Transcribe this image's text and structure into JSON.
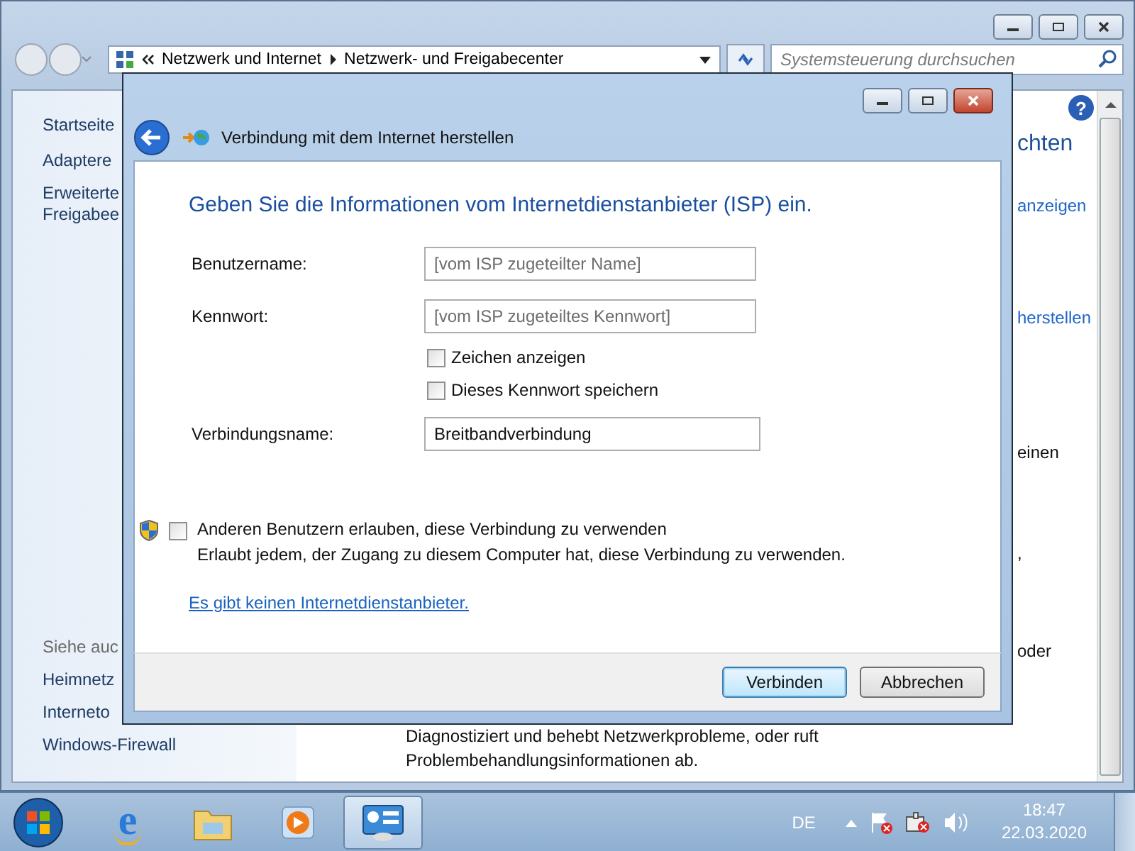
{
  "explorer": {
    "address_bar": {
      "segments": [
        "Netzwerk und Internet",
        "Netzwerk- und Freigabecenter"
      ]
    },
    "search": {
      "placeholder": "Systemsteuerung durchsuchen"
    },
    "help_glyph": "?",
    "sidebar": {
      "items": [
        "Startseite",
        "Adaptere",
        "Erweiterte Freigabee"
      ]
    },
    "see_also": {
      "heading": "Siehe auc",
      "items": [
        "Heimnetz",
        "Interneto",
        "Windows-Firewall"
      ]
    },
    "right_fragments": [
      {
        "kind": "heading",
        "text": "chten"
      },
      {
        "kind": "link",
        "text": "anzeigen"
      },
      {
        "kind": "link",
        "text": "herstellen"
      },
      {
        "kind": "text",
        "text": "einen"
      },
      {
        "kind": "text",
        "text": ","
      },
      {
        "kind": "text",
        "text": "oder"
      }
    ],
    "troubleshoot_description": "Diagnostiziert und behebt Netzwerkprobleme, oder ruft Problembehandlungsinformationen ab."
  },
  "dialog": {
    "title": "Verbindung mit dem Internet herstellen",
    "heading": "Geben Sie die Informationen vom Internetdienstanbieter (ISP) ein.",
    "fields": [
      {
        "label": "Benutzername:",
        "placeholder": "[vom ISP zugeteilter Name]"
      },
      {
        "label": "Kennwort:",
        "placeholder": "[vom ISP zugeteiltes Kennwort]"
      }
    ],
    "checkboxes": [
      {
        "label": "Zeichen anzeigen",
        "checked": false
      },
      {
        "label": "Dieses Kennwort speichern",
        "checked": false
      }
    ],
    "connection_name": {
      "label": "Verbindungsname:",
      "value": "Breitbandverbindung"
    },
    "share": {
      "label": "Anderen Benutzern erlauben, diese Verbindung zu verwenden",
      "checked": false,
      "description": "Erlaubt jedem, der Zugang zu diesem Computer hat, diese Verbindung zu verwenden."
    },
    "link": "Es gibt keinen Internetdienstanbieter.",
    "buttons": [
      {
        "label": "Verbinden",
        "default": true
      },
      {
        "label": "Abbrechen",
        "default": false
      }
    ]
  },
  "taskbar": {
    "apps": [
      {
        "kind": "browser",
        "selected": false,
        "glyph": "e"
      },
      {
        "kind": "folder",
        "selected": false
      },
      {
        "kind": "media",
        "selected": false
      },
      {
        "kind": "control-panel",
        "selected": true
      }
    ],
    "language": "DE",
    "time": "18:47",
    "date": "22.03.2020"
  }
}
